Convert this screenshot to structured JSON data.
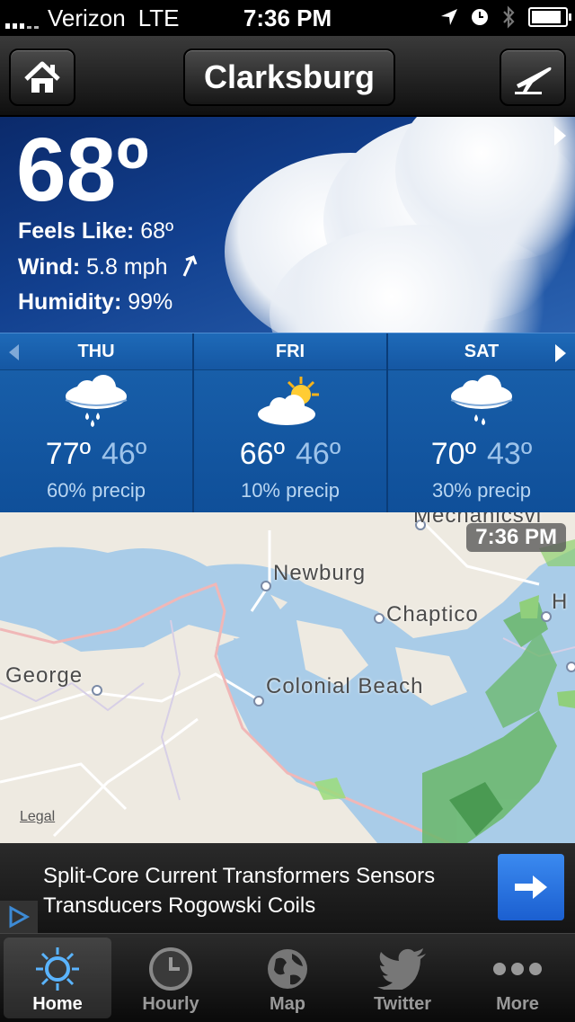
{
  "status_bar": {
    "carrier": "Verizon",
    "network": "LTE",
    "time": "7:36 PM"
  },
  "nav": {
    "city": "Clarksburg"
  },
  "current": {
    "temp": "68º",
    "feels_like_label": "Feels Like:",
    "feels_like_value": "68º",
    "wind_label": "Wind:",
    "wind_value": "5.8 mph",
    "humidity_label": "Humidity:",
    "humidity_value": "99%"
  },
  "forecast": [
    {
      "day": "THU",
      "high": "77º",
      "low": "46º",
      "precip": "60% precip",
      "icon": "rain-cloud-icon"
    },
    {
      "day": "FRI",
      "high": "66º",
      "low": "46º",
      "precip": "10% precip",
      "icon": "partly-sunny-icon"
    },
    {
      "day": "SAT",
      "high": "70º",
      "low": "43º",
      "precip": "30% precip",
      "icon": "rain-cloud-icon"
    }
  ],
  "map": {
    "time": "7:36 PM",
    "legal": "Legal",
    "labels": [
      "Mechanicsvi",
      "Newburg",
      "Chaptico",
      "George",
      "Colonial Beach",
      "H"
    ]
  },
  "ad": {
    "text": "Split-Core Current Transformers Sensors Transducers Rogowski Coils"
  },
  "tabs": [
    {
      "label": "Home",
      "icon": "sun-icon",
      "active": true
    },
    {
      "label": "Hourly",
      "icon": "clock-icon"
    },
    {
      "label": "Map",
      "icon": "globe-icon"
    },
    {
      "label": "Twitter",
      "icon": "twitter-bird-icon"
    },
    {
      "label": "More",
      "icon": "more-dots-icon"
    }
  ],
  "colors": {
    "sky": "#12408f",
    "forecast": "#1a62ad",
    "water": "#a9cce8",
    "land": "#eeeae1",
    "ad_button": "#1b5fd0"
  }
}
